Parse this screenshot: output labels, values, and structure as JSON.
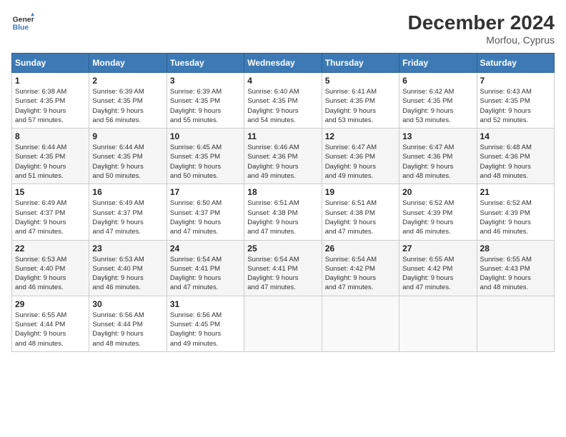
{
  "header": {
    "logo_line1": "General",
    "logo_line2": "Blue",
    "title": "December 2024",
    "subtitle": "Morfou, Cyprus"
  },
  "weekdays": [
    "Sunday",
    "Monday",
    "Tuesday",
    "Wednesday",
    "Thursday",
    "Friday",
    "Saturday"
  ],
  "days": [
    {
      "date": "",
      "info": ""
    },
    {
      "date": "",
      "info": ""
    },
    {
      "date": "",
      "info": ""
    },
    {
      "date": "",
      "info": ""
    },
    {
      "date": "",
      "info": ""
    },
    {
      "date": "",
      "info": ""
    },
    {
      "date": "1",
      "info": "Sunrise: 6:38 AM\nSunset: 4:35 PM\nDaylight: 9 hours\nand 57 minutes."
    },
    {
      "date": "2",
      "info": "Sunrise: 6:39 AM\nSunset: 4:35 PM\nDaylight: 9 hours\nand 56 minutes."
    },
    {
      "date": "3",
      "info": "Sunrise: 6:39 AM\nSunset: 4:35 PM\nDaylight: 9 hours\nand 55 minutes."
    },
    {
      "date": "4",
      "info": "Sunrise: 6:40 AM\nSunset: 4:35 PM\nDaylight: 9 hours\nand 54 minutes."
    },
    {
      "date": "5",
      "info": "Sunrise: 6:41 AM\nSunset: 4:35 PM\nDaylight: 9 hours\nand 53 minutes."
    },
    {
      "date": "6",
      "info": "Sunrise: 6:42 AM\nSunset: 4:35 PM\nDaylight: 9 hours\nand 53 minutes."
    },
    {
      "date": "7",
      "info": "Sunrise: 6:43 AM\nSunset: 4:35 PM\nDaylight: 9 hours\nand 52 minutes."
    },
    {
      "date": "8",
      "info": "Sunrise: 6:44 AM\nSunset: 4:35 PM\nDaylight: 9 hours\nand 51 minutes."
    },
    {
      "date": "9",
      "info": "Sunrise: 6:44 AM\nSunset: 4:35 PM\nDaylight: 9 hours\nand 50 minutes."
    },
    {
      "date": "10",
      "info": "Sunrise: 6:45 AM\nSunset: 4:35 PM\nDaylight: 9 hours\nand 50 minutes."
    },
    {
      "date": "11",
      "info": "Sunrise: 6:46 AM\nSunset: 4:36 PM\nDaylight: 9 hours\nand 49 minutes."
    },
    {
      "date": "12",
      "info": "Sunrise: 6:47 AM\nSunset: 4:36 PM\nDaylight: 9 hours\nand 49 minutes."
    },
    {
      "date": "13",
      "info": "Sunrise: 6:47 AM\nSunset: 4:36 PM\nDaylight: 9 hours\nand 48 minutes."
    },
    {
      "date": "14",
      "info": "Sunrise: 6:48 AM\nSunset: 4:36 PM\nDaylight: 9 hours\nand 48 minutes."
    },
    {
      "date": "15",
      "info": "Sunrise: 6:49 AM\nSunset: 4:37 PM\nDaylight: 9 hours\nand 47 minutes."
    },
    {
      "date": "16",
      "info": "Sunrise: 6:49 AM\nSunset: 4:37 PM\nDaylight: 9 hours\nand 47 minutes."
    },
    {
      "date": "17",
      "info": "Sunrise: 6:50 AM\nSunset: 4:37 PM\nDaylight: 9 hours\nand 47 minutes."
    },
    {
      "date": "18",
      "info": "Sunrise: 6:51 AM\nSunset: 4:38 PM\nDaylight: 9 hours\nand 47 minutes."
    },
    {
      "date": "19",
      "info": "Sunrise: 6:51 AM\nSunset: 4:38 PM\nDaylight: 9 hours\nand 47 minutes."
    },
    {
      "date": "20",
      "info": "Sunrise: 6:52 AM\nSunset: 4:39 PM\nDaylight: 9 hours\nand 46 minutes."
    },
    {
      "date": "21",
      "info": "Sunrise: 6:52 AM\nSunset: 4:39 PM\nDaylight: 9 hours\nand 46 minutes."
    },
    {
      "date": "22",
      "info": "Sunrise: 6:53 AM\nSunset: 4:40 PM\nDaylight: 9 hours\nand 46 minutes."
    },
    {
      "date": "23",
      "info": "Sunrise: 6:53 AM\nSunset: 4:40 PM\nDaylight: 9 hours\nand 46 minutes."
    },
    {
      "date": "24",
      "info": "Sunrise: 6:54 AM\nSunset: 4:41 PM\nDaylight: 9 hours\nand 47 minutes."
    },
    {
      "date": "25",
      "info": "Sunrise: 6:54 AM\nSunset: 4:41 PM\nDaylight: 9 hours\nand 47 minutes."
    },
    {
      "date": "26",
      "info": "Sunrise: 6:54 AM\nSunset: 4:42 PM\nDaylight: 9 hours\nand 47 minutes."
    },
    {
      "date": "27",
      "info": "Sunrise: 6:55 AM\nSunset: 4:42 PM\nDaylight: 9 hours\nand 47 minutes."
    },
    {
      "date": "28",
      "info": "Sunrise: 6:55 AM\nSunset: 4:43 PM\nDaylight: 9 hours\nand 48 minutes."
    },
    {
      "date": "29",
      "info": "Sunrise: 6:55 AM\nSunset: 4:44 PM\nDaylight: 9 hours\nand 48 minutes."
    },
    {
      "date": "30",
      "info": "Sunrise: 6:56 AM\nSunset: 4:44 PM\nDaylight: 9 hours\nand 48 minutes."
    },
    {
      "date": "31",
      "info": "Sunrise: 6:56 AM\nSunset: 4:45 PM\nDaylight: 9 hours\nand 49 minutes."
    },
    {
      "date": "",
      "info": ""
    },
    {
      "date": "",
      "info": ""
    },
    {
      "date": "",
      "info": ""
    },
    {
      "date": "",
      "info": ""
    },
    {
      "date": "",
      "info": ""
    }
  ]
}
